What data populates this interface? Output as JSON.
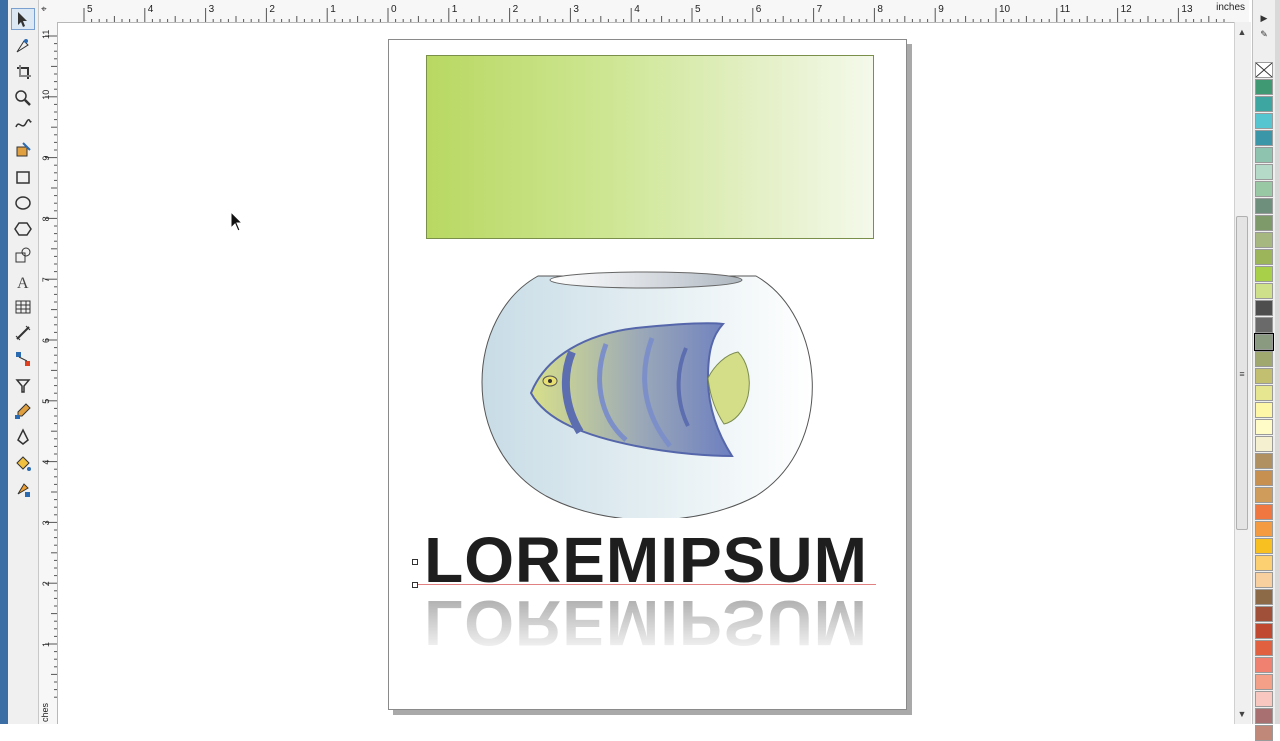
{
  "ruler": {
    "units_label": "inches",
    "vertical_units_label": "ches",
    "h_ticks": [
      "5",
      "4",
      "3",
      "2",
      "1",
      "0",
      "1",
      "2",
      "3",
      "4",
      "5",
      "6",
      "7",
      "8",
      "9",
      "10",
      "11",
      "12",
      "13"
    ],
    "v_ticks": [
      "11",
      "10",
      "9",
      "8",
      "7",
      "6",
      "5",
      "4",
      "3",
      "2",
      "1"
    ]
  },
  "document": {
    "title_text": "LOREMIPSUM",
    "reflection_text": "LOREMIPSUM"
  },
  "colors": {
    "gradient_start": "#b8d862",
    "gradient_end": "#f4f9ea",
    "fish_blue": "#6d7fc0",
    "fish_yellow": "#d4de88"
  },
  "tools": [
    "pick-tool-icon",
    "shape-tool-icon",
    "crop-tool-icon",
    "zoom-tool-icon",
    "freehand-tool-icon",
    "smart-fill-tool-icon",
    "rectangle-tool-icon",
    "ellipse-tool-icon",
    "polygon-tool-icon",
    "basic-shapes-tool-icon",
    "text-tool-icon",
    "table-tool-icon",
    "dimension-tool-icon",
    "connector-tool-icon",
    "blend-tool-icon",
    "eyedropper-tool-icon",
    "outline-pen-tool-icon",
    "fill-tool-icon",
    "interactive-fill-tool-icon"
  ],
  "palette": [
    "#ffffff",
    "#3f9a74",
    "#3ea6a0",
    "#55c6d0",
    "#3b96a8",
    "#8ec3b0",
    "#b6dac8",
    "#98c8a4",
    "#6e8f7c",
    "#7f9a6a",
    "#a6b880",
    "#9cb45a",
    "#a8d048",
    "#cfe08a",
    "#4e4e4e",
    "#6a6a6a",
    "#8a9a80",
    "#a0a870",
    "#c2c070",
    "#e6e690",
    "#fff7a8",
    "#fffcc8",
    "#f4f0d0",
    "#b09060",
    "#c89050",
    "#d09c5c",
    "#f07840",
    "#f49a40",
    "#f8c020",
    "#fcd070",
    "#f8d0a0",
    "#8c6a48",
    "#a05038",
    "#c04830",
    "#e06040",
    "#f08070",
    "#f4a088",
    "#f8c8c0",
    "#a87070",
    "#c08878"
  ]
}
